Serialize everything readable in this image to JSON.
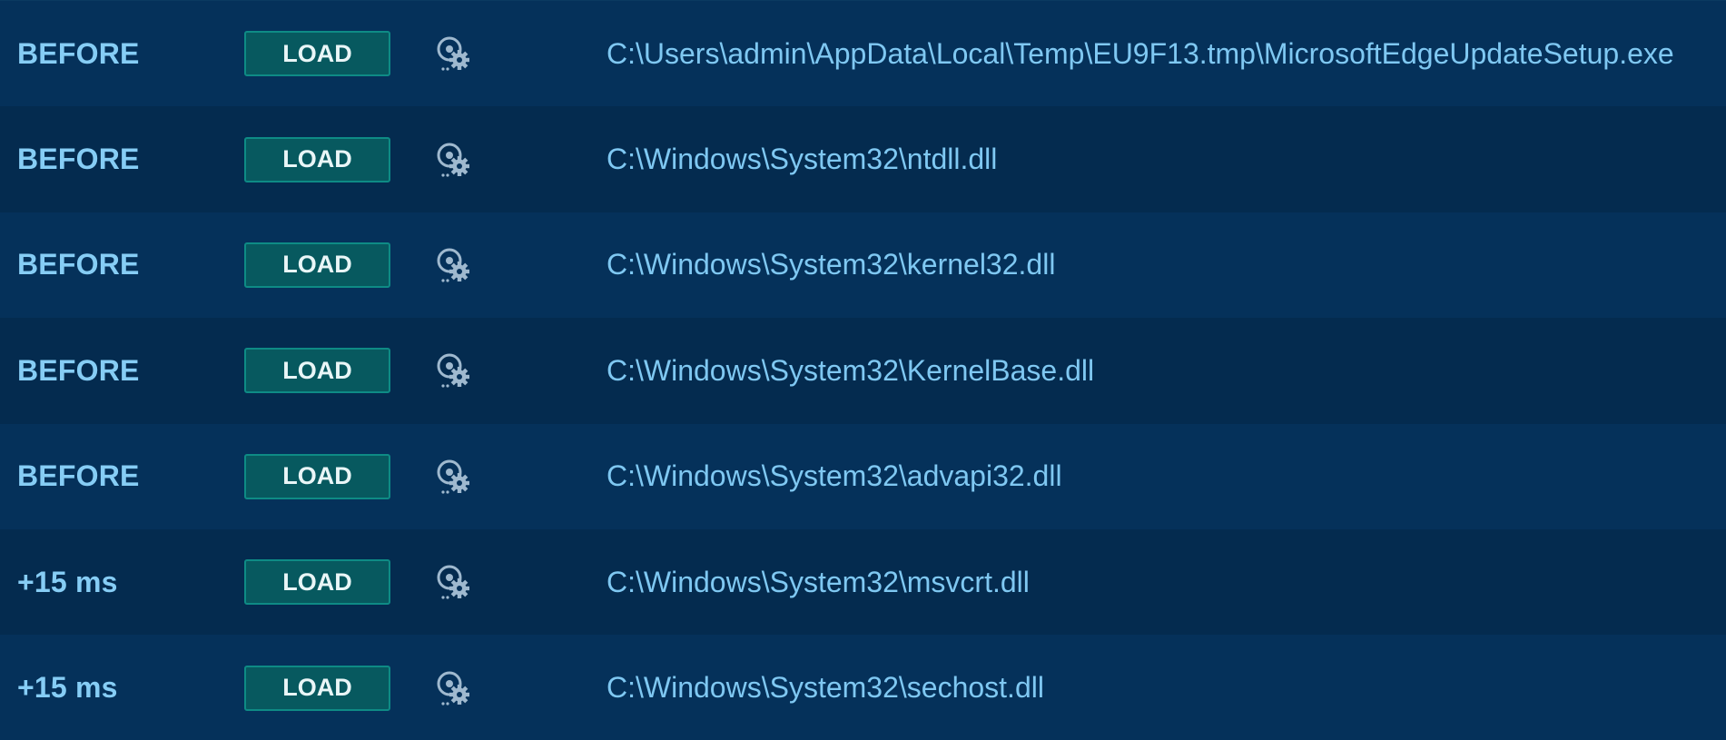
{
  "events": [
    {
      "time": "BEFORE",
      "operation": "LOAD",
      "icon": "library-gear-icon",
      "path": "C:\\Users\\admin\\AppData\\Local\\Temp\\EU9F13.tmp\\MicrosoftEdgeUpdateSetup.exe"
    },
    {
      "time": "BEFORE",
      "operation": "LOAD",
      "icon": "library-gear-icon",
      "path": "C:\\Windows\\System32\\ntdll.dll"
    },
    {
      "time": "BEFORE",
      "operation": "LOAD",
      "icon": "library-gear-icon",
      "path": "C:\\Windows\\System32\\kernel32.dll"
    },
    {
      "time": "BEFORE",
      "operation": "LOAD",
      "icon": "library-gear-icon",
      "path": "C:\\Windows\\System32\\KernelBase.dll"
    },
    {
      "time": "BEFORE",
      "operation": "LOAD",
      "icon": "library-gear-icon",
      "path": "C:\\Windows\\System32\\advapi32.dll"
    },
    {
      "time": "+15 ms",
      "operation": "LOAD",
      "icon": "library-gear-icon",
      "path": "C:\\Windows\\System32\\msvcrt.dll"
    },
    {
      "time": "+15 ms",
      "operation": "LOAD",
      "icon": "library-gear-icon",
      "path": "C:\\Windows\\System32\\sechost.dll"
    }
  ],
  "colors": {
    "background": "#042a4a",
    "row_odd": "#05315a",
    "row_even": "#042b4f",
    "text": "#86cdf5",
    "path_text": "#7fc8f2",
    "badge_bg": "#07595f",
    "badge_border": "#0e8b85",
    "icon": "#9fb9cf"
  }
}
